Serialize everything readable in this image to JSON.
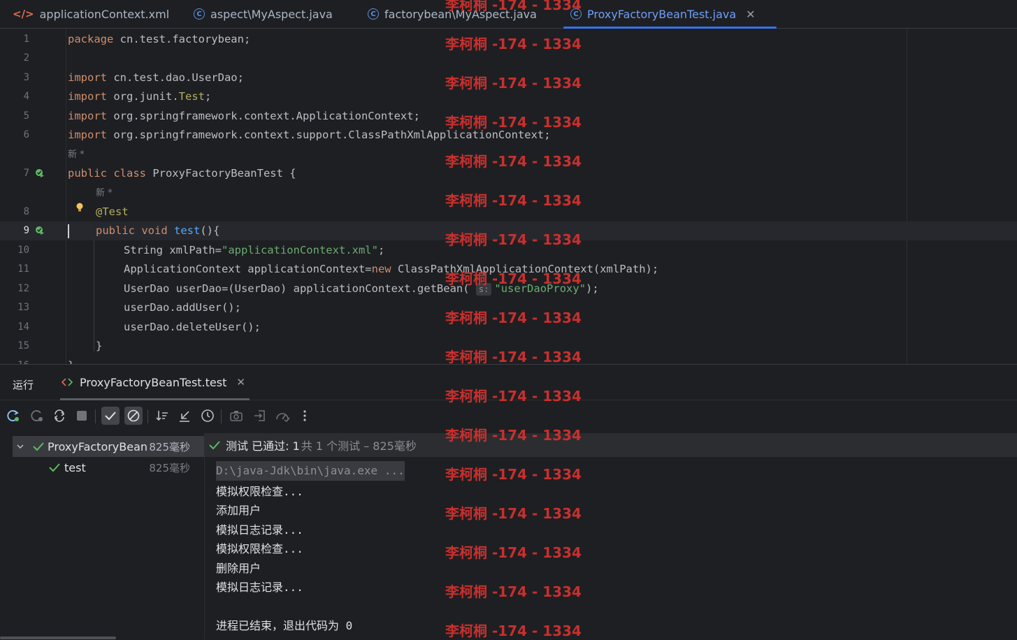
{
  "tabs": [
    {
      "label": "applicationContext.xml",
      "icon": "xml-file-icon",
      "active": false
    },
    {
      "label": "aspect\\MyAspect.java",
      "icon": "java-class-icon",
      "active": false
    },
    {
      "label": "factorybean\\MyAspect.java",
      "icon": "java-class-icon",
      "active": false
    },
    {
      "label": "ProxyFactoryBeanTest.java",
      "icon": "java-class-icon",
      "active": true
    }
  ],
  "editor": {
    "lines": [
      {
        "num": "1",
        "text": "package cn.test.factorybean;"
      },
      {
        "num": "2",
        "text": ""
      },
      {
        "num": "3",
        "text": "import cn.test.dao.UserDao;"
      },
      {
        "num": "4",
        "text": "import org.junit.Test;"
      },
      {
        "num": "5",
        "text": "import org.springframework.context.ApplicationContext;"
      },
      {
        "num": "6",
        "text": "import org.springframework.context.support.ClassPathXmlApplicationContext;"
      },
      {
        "num": "7",
        "text": "public class ProxyFactoryBeanTest {"
      },
      {
        "num": "8",
        "text": "@Test"
      },
      {
        "num": "9",
        "text": "public void test(){"
      },
      {
        "num": "10",
        "text": "String xmlPath=\"applicationContext.xml\";"
      },
      {
        "num": "11",
        "text": "ApplicationContext applicationContext=new ClassPathXmlApplicationContext(xmlPath);"
      },
      {
        "num": "12",
        "text": "UserDao userDao=(UserDao) applicationContext.getBean( \"userDaoProxy\");"
      },
      {
        "num": "13",
        "text": "userDao.addUser();"
      },
      {
        "num": "14",
        "text": "userDao.deleteUser();"
      },
      {
        "num": "15",
        "text": "}"
      },
      {
        "num": "16",
        "text": "}"
      }
    ],
    "meta_label": "新 *",
    "param_hint": "s:"
  },
  "run": {
    "title": "运行",
    "tab_label": "ProxyFactoryBeanTest.test",
    "tree": [
      {
        "label": "ProxyFactoryBean",
        "time": "825毫秒"
      },
      {
        "label": "test",
        "time": "825毫秒"
      }
    ],
    "status_pass": "测试 已通过: 1",
    "status_detail": "共 1 个测试 – 825毫秒",
    "output": [
      "D:\\java-Jdk\\bin\\java.exe ...",
      "模拟权限检查...",
      "添加用户",
      "模拟日志记录...",
      "模拟权限检查...",
      "删除用户",
      "模拟日志记录...",
      "",
      "进程已结束，退出代码为 0"
    ]
  },
  "watermark": "李柯桐 -174 - 1334",
  "colors": {
    "accent": "#3574f0",
    "success": "#5fb865",
    "watermark": "#c8302e"
  }
}
